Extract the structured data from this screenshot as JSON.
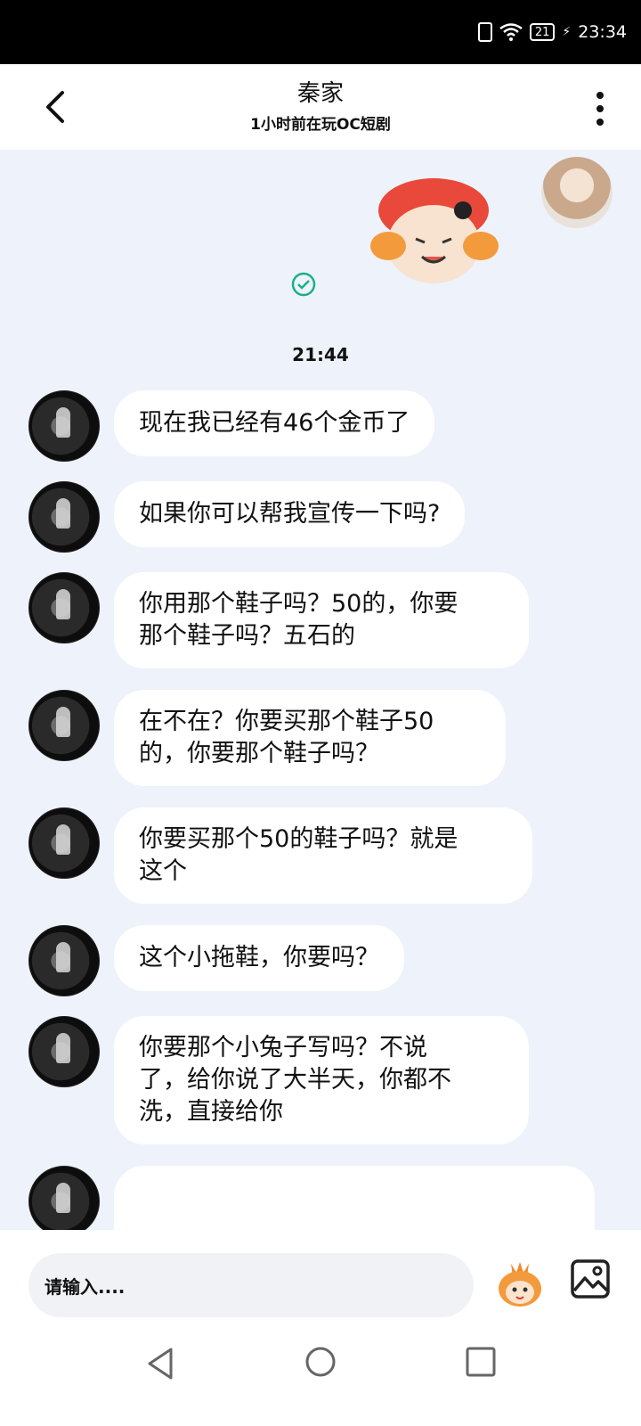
{
  "status_bar": {
    "battery": "21",
    "time": "23:34"
  },
  "header": {
    "title": "秦家",
    "subtitle": "1小时前在玩OC短剧"
  },
  "chat": {
    "time_divider": "21:44",
    "messages": [
      {
        "text": "现在我已经有46个金币了"
      },
      {
        "text": "如果你可以帮我宣传一下吗?"
      },
      {
        "text": "你用那个鞋子吗？50的，你要\n那个鞋子吗？五石的"
      },
      {
        "text": "在不在？你要买那个鞋子50\n的，你要那个鞋子吗？"
      },
      {
        "text": "你要买那个50的鞋子吗？就是\n这个"
      },
      {
        "text": "这个小拖鞋，你要吗？"
      },
      {
        "text": "你要那个小兔子写吗？不说\n了，给你说了大半天，你都不\n洗，直接给你"
      }
    ]
  },
  "input": {
    "placeholder": "请输入...."
  },
  "icons": {
    "back": "chevron-left-icon",
    "more": "more-vertical-icon",
    "check": "check-circle-icon",
    "emoji": "emoji-sticker-icon",
    "image": "image-icon",
    "nav_back": "triangle-back-icon",
    "nav_home": "circle-home-icon",
    "nav_recent": "square-recent-icon"
  },
  "colors": {
    "chat_background": "#eef2fa",
    "bubble": "#ffffff",
    "check": "#1ab08a",
    "status_bar": "#000000"
  }
}
